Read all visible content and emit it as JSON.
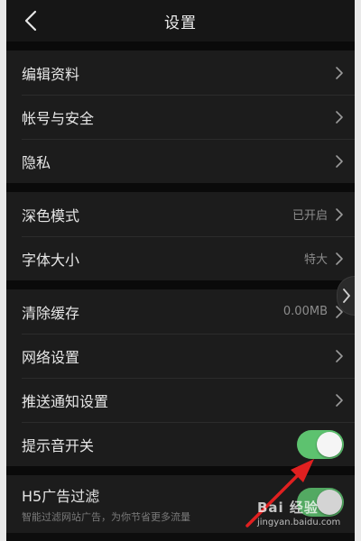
{
  "nav": {
    "title": "设置"
  },
  "groups": [
    {
      "items": [
        {
          "label": "编辑资料"
        },
        {
          "label": "帐号与安全"
        },
        {
          "label": "隐私"
        }
      ]
    },
    {
      "items": [
        {
          "label": "深色模式",
          "value": "已开启"
        },
        {
          "label": "字体大小",
          "value": "特大"
        }
      ]
    },
    {
      "items": [
        {
          "label": "清除缓存",
          "value": "0.00MB"
        },
        {
          "label": "网络设置"
        },
        {
          "label": "推送通知设置"
        },
        {
          "label": "提示音开关",
          "toggle": true
        }
      ]
    },
    {
      "items": [
        {
          "label": "H5广告过滤",
          "subtitle": "智能过滤网站广告，为你节省更多流量",
          "toggle": true
        }
      ]
    }
  ],
  "watermark": {
    "logo": "Bai 经验",
    "url": "jingyan.baidu.com"
  },
  "colors": {
    "toggle_on": "#5dc26f",
    "background": "#0d0d0d",
    "row_bg": "#1c1c1c",
    "annotation_arrow": "#e02020"
  },
  "icons": {
    "back": "chevron-left-icon",
    "row_chevron": "chevron-right-icon",
    "side_tab": "chevron-right-icon"
  }
}
